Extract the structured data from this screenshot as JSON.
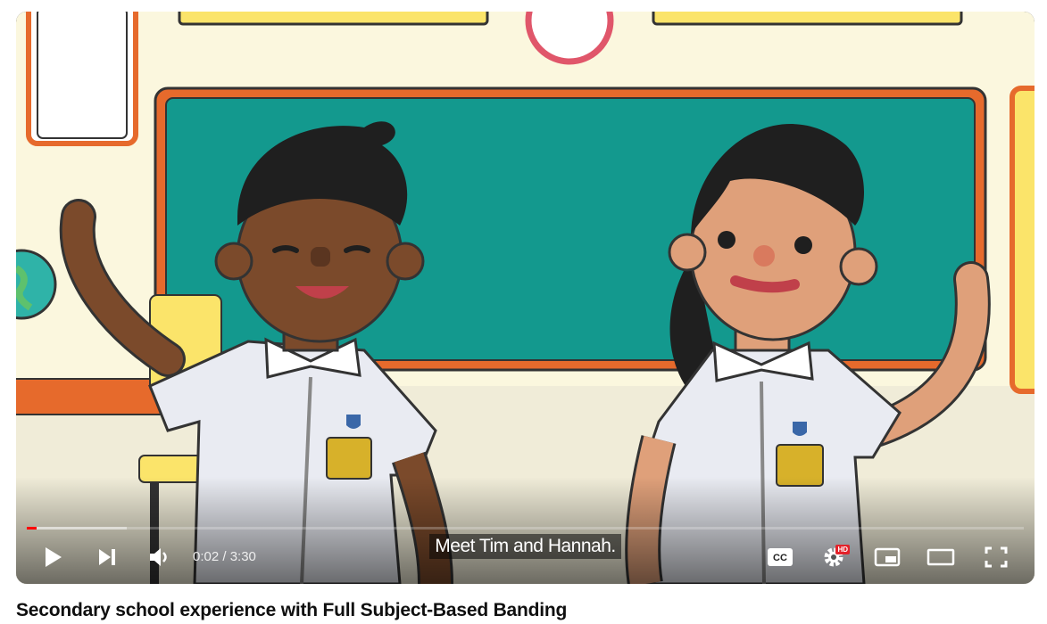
{
  "video": {
    "caption": "Meet Tim and Hannah.",
    "current_time": "0:02",
    "duration": "3:30",
    "time_display": "0:02 / 3:30",
    "played_fraction": 0.01,
    "buffered_fraction": 0.1,
    "quality_badge": "HD",
    "cc_label": "CC"
  },
  "controls": {
    "icons": [
      "play-icon",
      "next-icon",
      "volume-icon",
      "captions-icon",
      "settings-icon",
      "miniplayer-icon",
      "theater-icon",
      "fullscreen-icon"
    ]
  },
  "colors": {
    "progress_played": "#ff0000",
    "hd_badge": "#e3222a",
    "chalkboard": "#13998e",
    "board_frame": "#e66a2c"
  },
  "page": {
    "title": "Secondary school experience with Full Subject-Based Banding"
  }
}
